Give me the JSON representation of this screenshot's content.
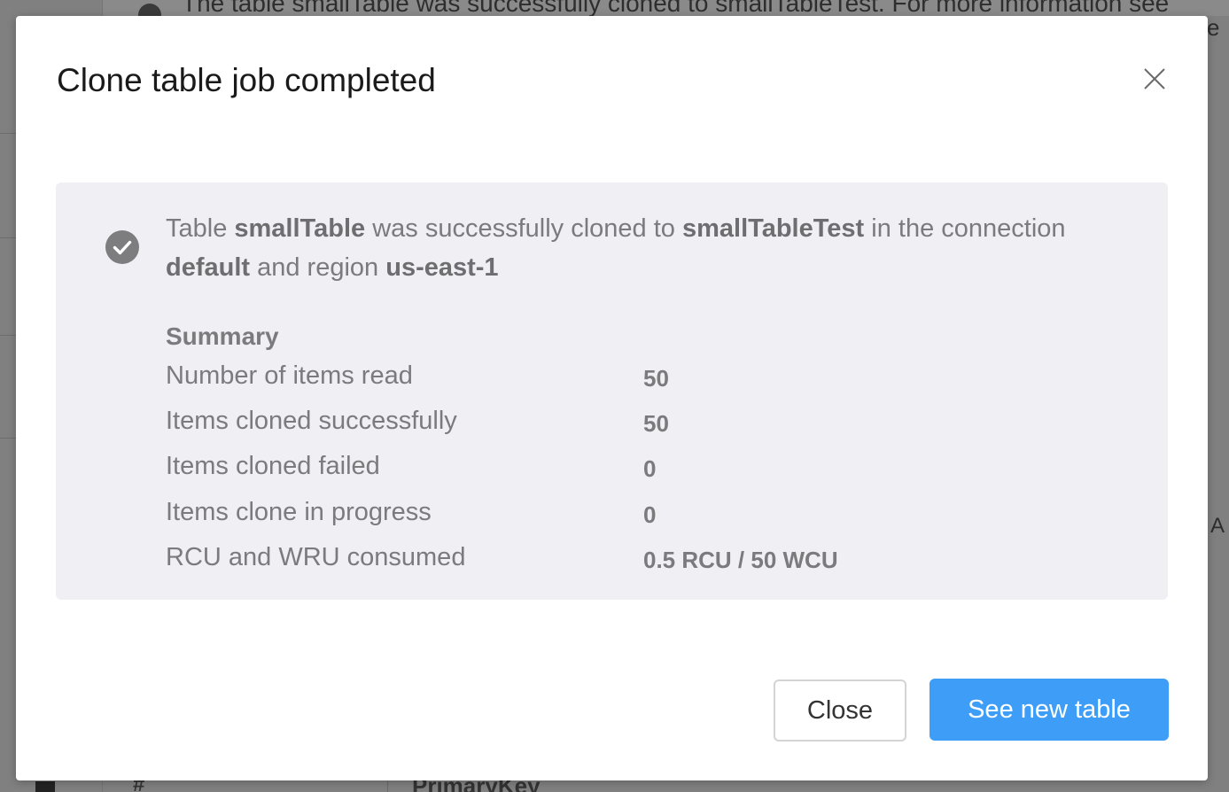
{
  "background": {
    "banner_text": "The table smallTable was successfully cloned to smallTableTest. For more information see",
    "right_edge_text_top": "e",
    "right_edge_text_mid": "A",
    "table_header_hash": "#",
    "table_header_primary_key": "PrimaryKey"
  },
  "modal": {
    "title": "Clone table job completed",
    "close_icon": "close-x-icon",
    "message": {
      "prefix": "Table ",
      "source_table": "smallTable",
      "middle_1": " was successfully cloned to ",
      "target_table": "smallTableTest",
      "middle_2": " in the connection ",
      "connection": "default",
      "middle_3": " and region ",
      "region": "us-east-1"
    },
    "summary": {
      "heading": "Summary",
      "rows": [
        {
          "label": "Number of items read",
          "value": "50"
        },
        {
          "label": "Items cloned successfully",
          "value": "50"
        },
        {
          "label": "Items cloned failed",
          "value": "0"
        },
        {
          "label": "Items clone in progress",
          "value": "0"
        },
        {
          "label": "RCU and WRU consumed",
          "value": "0.5 RCU / 50 WCU"
        }
      ]
    },
    "buttons": {
      "close_label": "Close",
      "primary_label": "See new table"
    }
  },
  "colors": {
    "primary_button": "#3d9df7",
    "panel_background": "#efeff4",
    "overlay": "#808080"
  }
}
